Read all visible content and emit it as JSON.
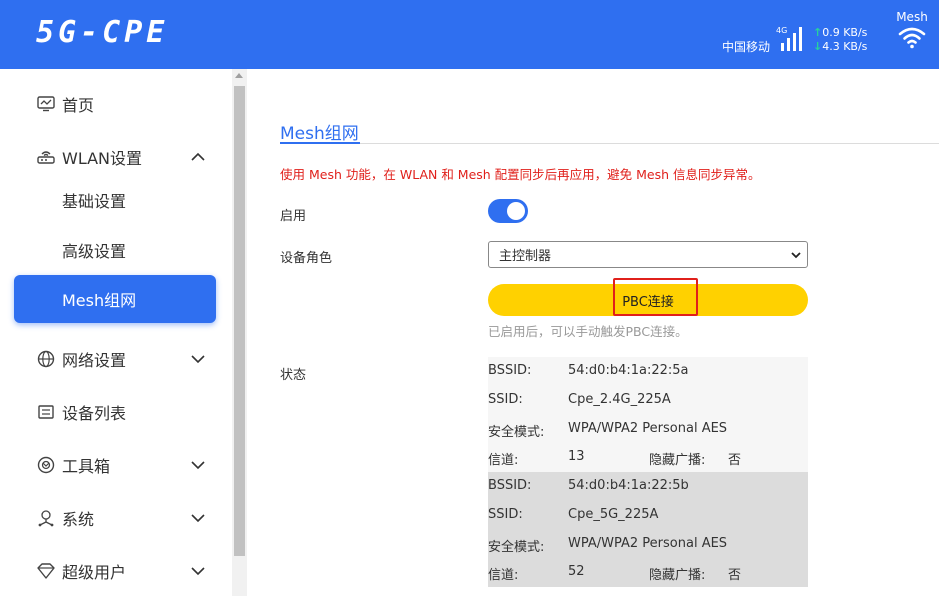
{
  "header": {
    "logo": "5G-CPE",
    "carrier": "中国移动",
    "network_type": "4G",
    "upload_rate": "0.9 KB/s",
    "download_rate": "4.3 KB/s",
    "mesh_label": "Mesh",
    "colors": {
      "bar": "#2f6ff0",
      "rate_arrow": "#27d19d"
    }
  },
  "sidebar": {
    "items": [
      {
        "label": "首页",
        "icon": "monitor-icon"
      },
      {
        "label": "WLAN设置",
        "icon": "router-icon",
        "expanded": true
      },
      {
        "label": "基础设置"
      },
      {
        "label": "高级设置"
      },
      {
        "label": "Mesh组网",
        "active": true
      },
      {
        "label": "网络设置",
        "icon": "globe-icon"
      },
      {
        "label": "设备列表",
        "icon": "list-icon"
      },
      {
        "label": "工具箱",
        "icon": "toolbox-icon"
      },
      {
        "label": "系统",
        "icon": "system-icon"
      },
      {
        "label": "超级用户",
        "icon": "diamond-icon"
      }
    ]
  },
  "main": {
    "tab_title": "Mesh组网",
    "warning": "使用 Mesh 功能，在 WLAN 和 Mesh 配置同步后再应用，避免 Mesh 信息同步异常。",
    "enable_label": "启用",
    "enabled": true,
    "role_label": "设备角色",
    "role_value": "主控制器",
    "pbc_button": "PBC连接",
    "pbc_hint": "已启用后，可以手动触发PBC连接。",
    "status_label": "状态",
    "status": [
      {
        "bssid_label": "BSSID:",
        "bssid": "54:d0:b4:1a:22:5a",
        "ssid_label": "SSID:",
        "ssid": "Cpe_2.4G_225A",
        "security_label": "安全模式:",
        "security": "WPA/WPA2 Personal AES",
        "channel_label": "信道:",
        "channel": "13",
        "hidden_label": "隐藏广播:",
        "hidden": "否"
      },
      {
        "bssid_label": "BSSID:",
        "bssid": "54:d0:b4:1a:22:5b",
        "ssid_label": "SSID:",
        "ssid": "Cpe_5G_225A",
        "security_label": "安全模式:",
        "security": "WPA/WPA2 Personal AES",
        "channel_label": "信道:",
        "channel": "52",
        "hidden_label": "隐藏广播:",
        "hidden": "否"
      }
    ]
  }
}
